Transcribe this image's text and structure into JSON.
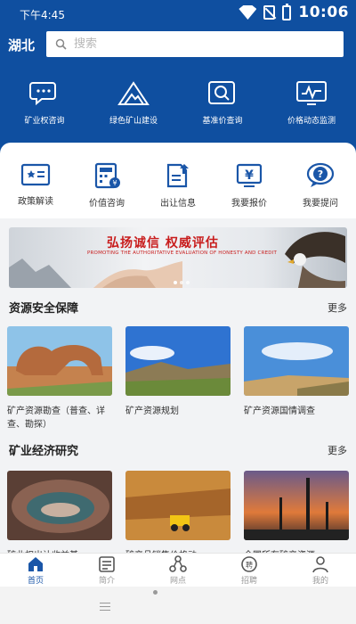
{
  "status": {
    "time_left": "下午4:45",
    "time_right": "10:06"
  },
  "header": {
    "region": "湖北",
    "search_placeholder": "搜索"
  },
  "top_menu": [
    {
      "label": "矿业权咨询"
    },
    {
      "label": "绿色矿山建设"
    },
    {
      "label": "基准价查询"
    },
    {
      "label": "价格动态监测"
    }
  ],
  "quick_links": [
    {
      "label": "政策解读"
    },
    {
      "label": "价值咨询"
    },
    {
      "label": "出让信息"
    },
    {
      "label": "我要报价"
    },
    {
      "label": "我要提问"
    }
  ],
  "banner": {
    "title": "弘扬诚信 权威评估",
    "subtitle": "PROMOTING THE AUTHORITATIVE EVALUATION OF HONESTY AND CREDIT"
  },
  "section1": {
    "title": "资源安全保障",
    "more": "更多",
    "items": [
      {
        "caption": "矿产资源勘查（普查、详查、勘探）"
      },
      {
        "caption": "矿产资源规划"
      },
      {
        "caption": "矿产资源国情调查"
      }
    ]
  },
  "section2": {
    "title": "矿业经济研究",
    "more": "更多",
    "items": [
      {
        "caption": "矿业权出让收益基"
      },
      {
        "caption": "矿产品销售价格动"
      },
      {
        "caption": "全国所有矿产资源"
      }
    ]
  },
  "bottom_nav": [
    {
      "label": "首页",
      "active": true
    },
    {
      "label": "简介",
      "active": false
    },
    {
      "label": "网点",
      "active": false
    },
    {
      "label": "招聘",
      "active": false
    },
    {
      "label": "我的",
      "active": false
    }
  ],
  "colors": {
    "primary": "#0f4fa0",
    "accent_red": "#c81c1c",
    "nav_active": "#1a56a8"
  }
}
